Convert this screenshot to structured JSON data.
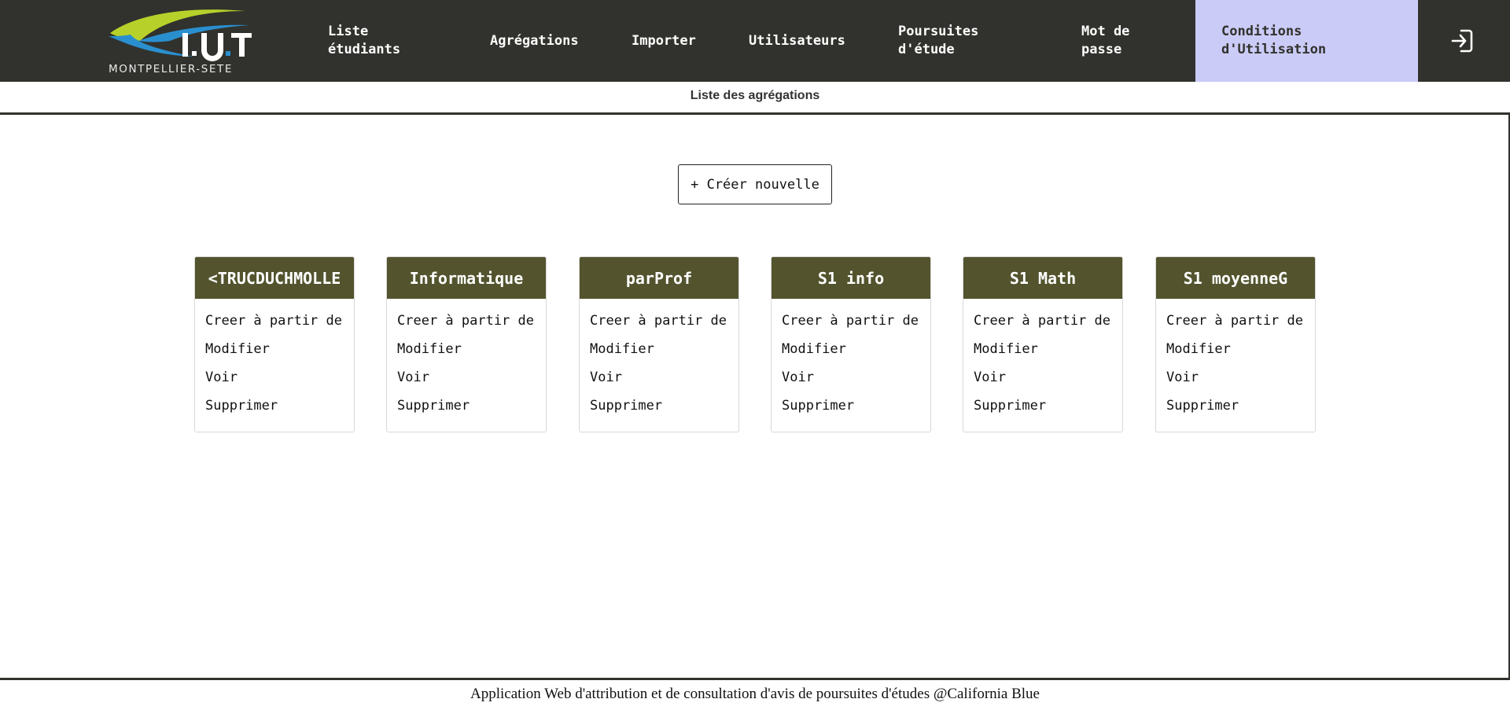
{
  "header": {
    "logo": {
      "mark_text": "I.U.T",
      "subtitle": "MONTPELLIER-SETE"
    },
    "nav": [
      {
        "id": "liste-etudiants",
        "lines": [
          "Liste",
          "étudiants"
        ]
      },
      {
        "id": "agregations",
        "lines": [
          "Agrégations"
        ]
      },
      {
        "id": "importer",
        "lines": [
          "Importer"
        ]
      },
      {
        "id": "utilisateurs",
        "lines": [
          "Utilisateurs"
        ]
      },
      {
        "id": "poursuites",
        "lines": [
          "Poursuites",
          "d'étude"
        ]
      },
      {
        "id": "mot-de-passe",
        "lines": [
          "Mot de",
          "passe"
        ]
      },
      {
        "id": "conditions",
        "lines": [
          "Conditions",
          "d'Utilisation"
        ],
        "active": true
      }
    ],
    "login_icon": "login-icon"
  },
  "page": {
    "title": "Liste des agrégations",
    "create_button_label": "+ Créer nouvelle"
  },
  "aggregations": [
    {
      "name": "<TRUCDUCHMOLLE"
    },
    {
      "name": "Informatique"
    },
    {
      "name": "parProf"
    },
    {
      "name": "S1 info"
    },
    {
      "name": "S1 Math"
    },
    {
      "name": "S1 moyenneG"
    }
  ],
  "card_actions": [
    "Creer à partir de",
    "Modifier",
    "Voir",
    "Supprimer"
  ],
  "footer": {
    "text": "Application Web d'attribution et de consultation d'avis de poursuites d'études @California Blue"
  },
  "colors": {
    "nav_background": "#31322d",
    "nav_active_background": "#cbcbf7",
    "card_header": "#53542e",
    "logo_lime": "#b7d12a",
    "logo_blue": "#2a8fcf"
  }
}
